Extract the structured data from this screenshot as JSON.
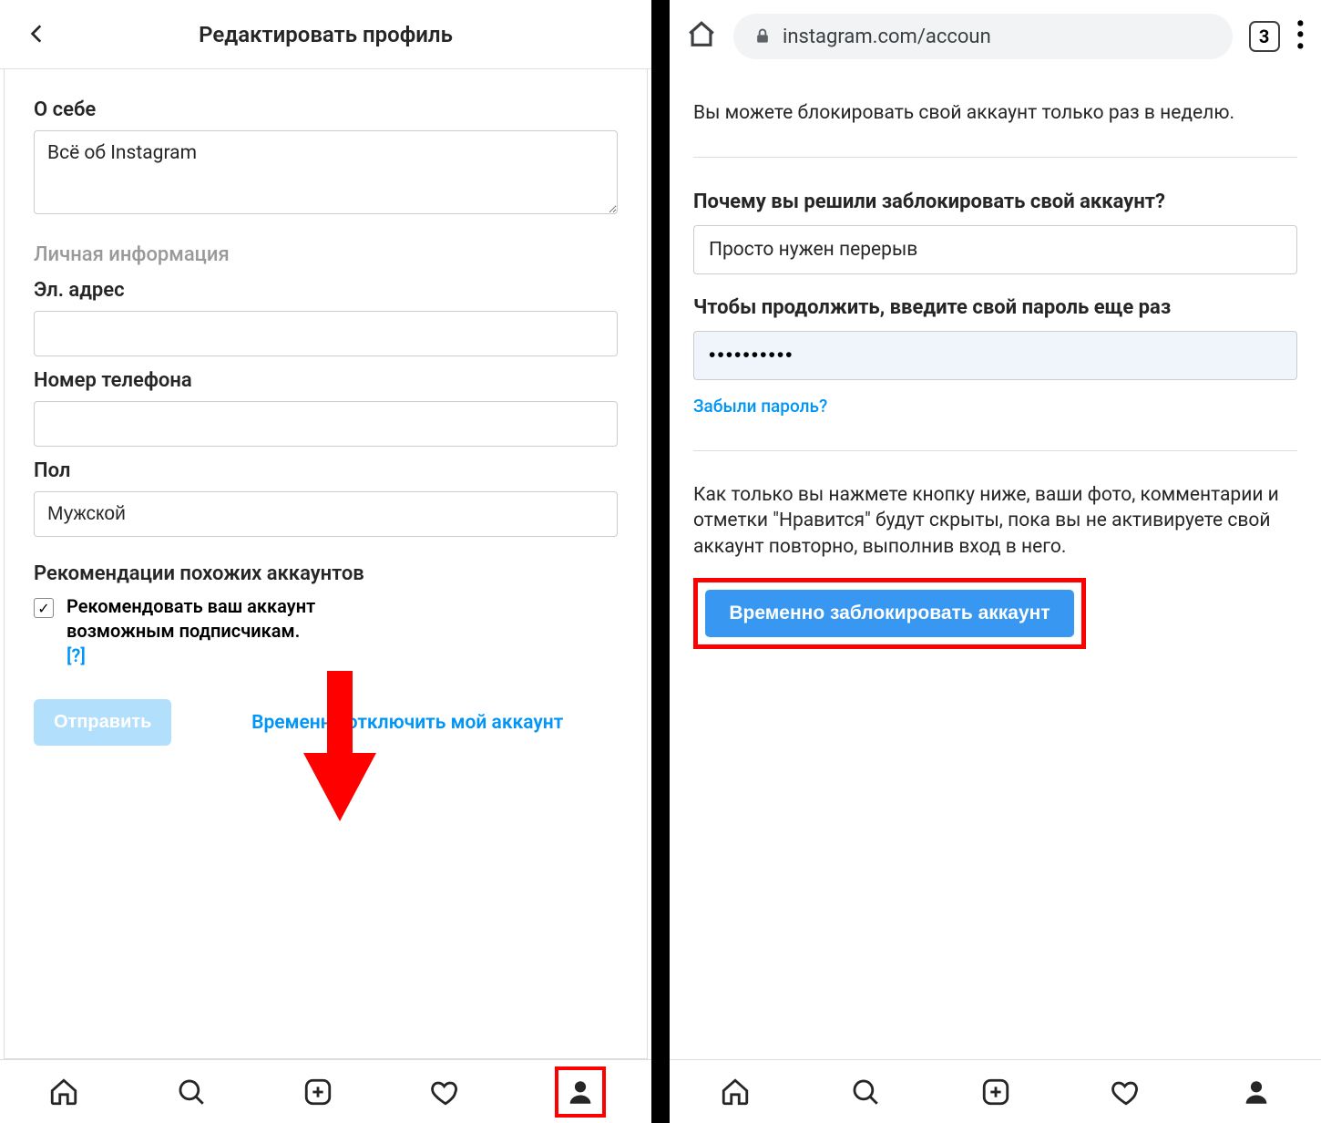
{
  "left": {
    "header_title": "Редактировать профиль",
    "about_label": "О себе",
    "about_value": "Всё об Instagram",
    "personal_label": "Личная информация",
    "email_label": "Эл. адрес",
    "email_value": "",
    "phone_label": "Номер телефона",
    "phone_value": "",
    "gender_label": "Пол",
    "gender_value": "Мужской",
    "reco_heading": "Рекомендации похожих аккаунтов",
    "reco_text": "Рекомендовать ваш аккаунт возможным подписчикам.",
    "reco_help": "[?]",
    "reco_checked": true,
    "submit_label": "Отправить",
    "disable_link": "Временно отключить мой аккаунт"
  },
  "right": {
    "url": "instagram.com/accoun",
    "tab_count": "3",
    "notice": "Вы можете блокировать свой аккаунт только раз в неделю.",
    "reason_label": "Почему вы решили заблокировать свой аккаунт?",
    "reason_value": "Просто нужен перерыв",
    "password_label": "Чтобы продолжить, введите свой пароль еще раз",
    "password_value": "••••••••••",
    "forgot_label": "Забыли пароль?",
    "explain": "Как только вы нажмете кнопку ниже, ваши фото, комментарии и отметки \"Нравится\" будут скрыты, пока вы не активируете свой аккаунт повторно, выполнив вход в него.",
    "block_button": "Временно заблокировать аккаунт"
  }
}
